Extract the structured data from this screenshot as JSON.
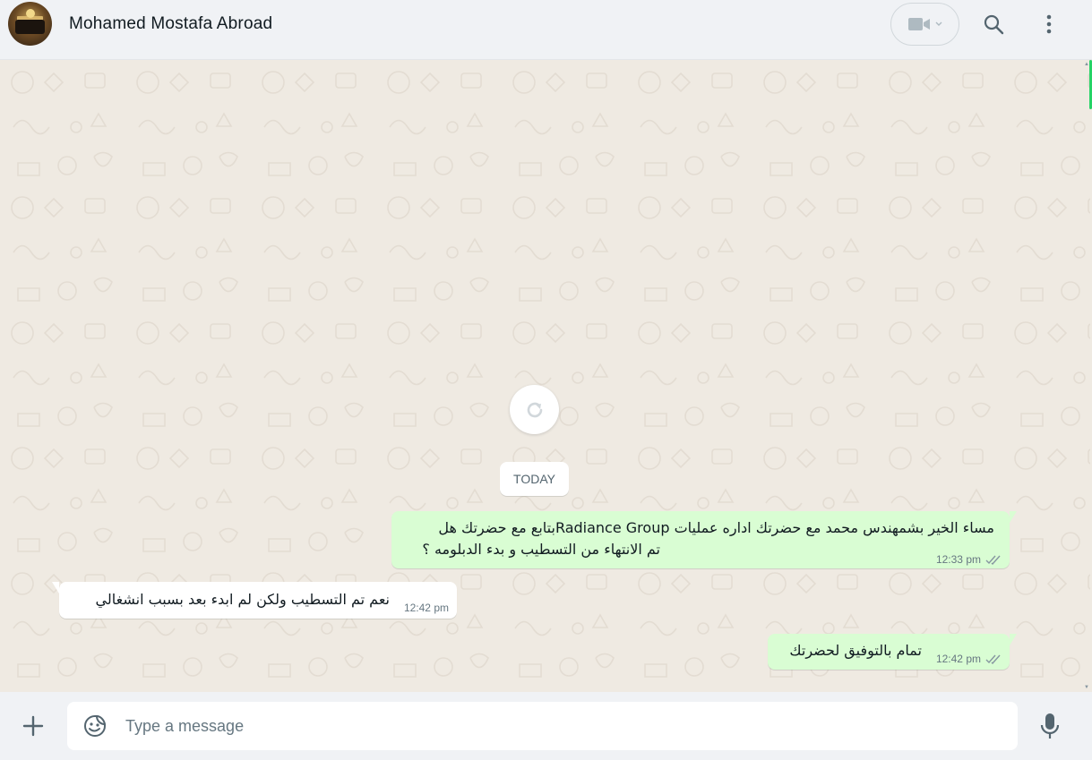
{
  "header": {
    "contact_name": "Mohamed Mostafa Abroad",
    "avatar_icon": "contact-photo",
    "video_icon": "video-camera-icon",
    "search_icon": "search-icon",
    "menu_icon": "kebab-menu-icon"
  },
  "chat": {
    "background_color": "#efeae2",
    "refresh_icon": "refresh-icon",
    "date_label": "TODAY",
    "messages": [
      {
        "direction": "outgoing",
        "lines": [
          "مساء الخير بشمهندس محمد مع  حضرتك اداره عمليات Radiance Groupبتابع مع حضرتك هل",
          "تم الانتهاء من التسطيب و بدء الدبلومه ؟"
        ],
        "time": "12:33 pm",
        "status": "read"
      },
      {
        "direction": "incoming",
        "lines": [
          "نعم تم التسطيب ولكن لم ابدء بعد بسبب انشغالي"
        ],
        "time": "12:42 pm"
      },
      {
        "direction": "outgoing",
        "lines": [
          "تمام بالتوفيق لحضرتك"
        ],
        "time": "12:42 pm",
        "status": "read"
      }
    ]
  },
  "composer": {
    "placeholder": "Type a message",
    "attach_icon": "plus-icon",
    "sticker_icon": "sticker-icon",
    "mic_icon": "microphone-icon"
  },
  "colors": {
    "outgoing_bubble": "#d9fdd3",
    "incoming_bubble": "#ffffff",
    "header_bg": "#f0f2f5",
    "read_ticks": "#8696a0",
    "accent": "#25d366"
  }
}
